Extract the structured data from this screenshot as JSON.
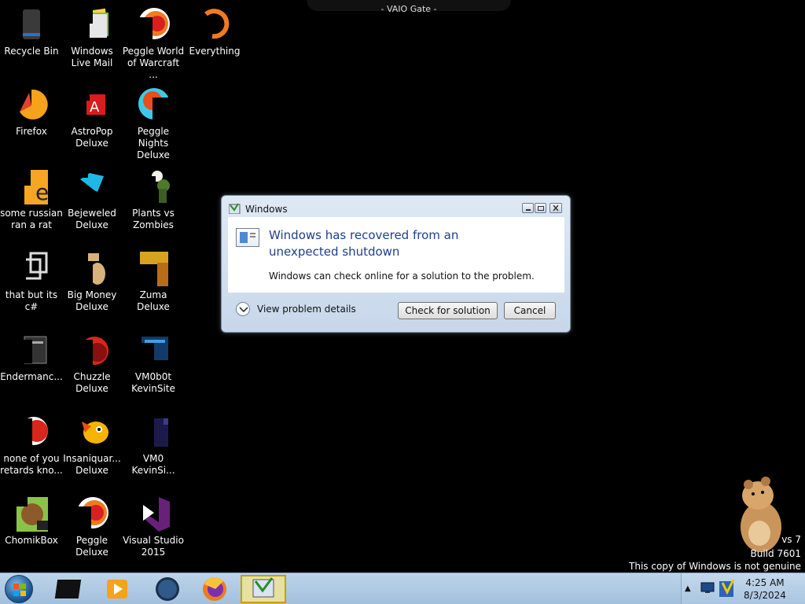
{
  "top_title": "- VAIO Gate -",
  "desktop_icons": [
    {
      "label": "Recycle Bin",
      "icon": "recycle-bin-icon"
    },
    {
      "label": "Windows Live Mail",
      "icon": "windows-live-mail-icon"
    },
    {
      "label": "Peggle World of Warcraft ...",
      "icon": "peggle-wow-icon"
    },
    {
      "label": "Everything",
      "icon": "everything-icon"
    },
    {
      "label": "Firefox",
      "icon": "firefox-icon"
    },
    {
      "label": "AstroPop Deluxe",
      "icon": "astropop-icon"
    },
    {
      "label": "Peggle Nights Deluxe",
      "icon": "peggle-nights-icon"
    },
    {
      "label": "some russian ran a rat",
      "icon": "russian-app-icon"
    },
    {
      "label": "Bejeweled Deluxe",
      "icon": "bejeweled-icon"
    },
    {
      "label": "Plants vs Zombies",
      "icon": "plants-vs-zombies-icon"
    },
    {
      "label": "that but its c#",
      "icon": "copy-files-icon"
    },
    {
      "label": "Big Money Deluxe",
      "icon": "big-money-icon"
    },
    {
      "label": "Zuma Deluxe",
      "icon": "zuma-icon"
    },
    {
      "label": "Endermanc...",
      "icon": "endermanch-icon"
    },
    {
      "label": "Chuzzle Deluxe",
      "icon": "chuzzle-icon"
    },
    {
      "label": "VM0b0t KevinSite",
      "icon": "vm0b0t-icon"
    },
    {
      "label": "none of you retards kno...",
      "icon": "red-app-icon"
    },
    {
      "label": "Insaniquar... Deluxe",
      "icon": "insaniquarium-icon"
    },
    {
      "label": "VM0 KevinSi...",
      "icon": "vm0-icon"
    },
    {
      "label": "ChomikBox",
      "icon": "chomikbox-icon"
    },
    {
      "label": "Peggle Deluxe",
      "icon": "peggle-deluxe-icon"
    },
    {
      "label": "Visual Studio 2015",
      "icon": "visual-studio-icon"
    }
  ],
  "dialog": {
    "title": "Windows",
    "heading": "Windows has recovered from an unexpected shutdown",
    "message": "Windows can check online for a solution to the problem.",
    "details_label": "View problem details",
    "check_button": "Check for solution",
    "cancel_button": "Cancel"
  },
  "watermark": {
    "line1": "vs 7",
    "line2": "Build 7601",
    "line3": "This copy of Windows is not genuine"
  },
  "taskbar": {
    "clock_time": "4:25 AM",
    "clock_date": "8/3/2024"
  }
}
